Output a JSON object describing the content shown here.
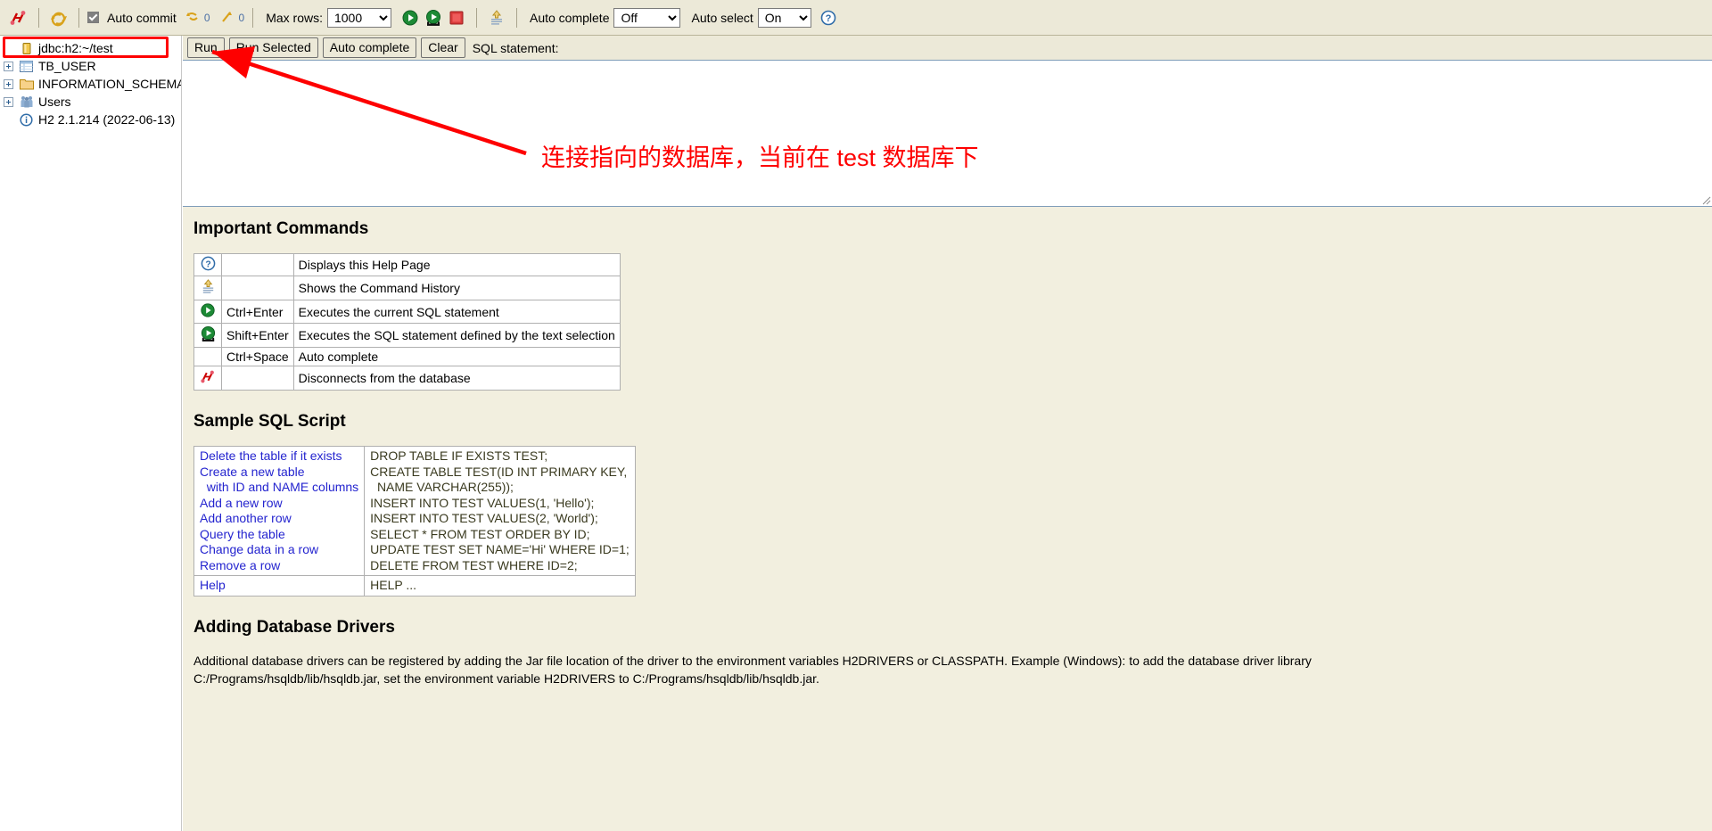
{
  "toolbar": {
    "disconnect_icon": "disconnect-icon",
    "refresh_icon": "refresh-icon",
    "auto_commit_label": "Auto commit",
    "auto_commit_checked": true,
    "commit_icon": "commit-icon",
    "commit_count": "0",
    "rollback_icon": "rollback-icon",
    "rollback_count": "0",
    "max_rows_label": "Max rows:",
    "max_rows_value": "1000",
    "max_rows_options": [
      "1000"
    ],
    "run_icon": "run-icon",
    "run_selected_icon": "run-selected-icon",
    "stop_icon": "stop-icon",
    "history_icon": "history-icon",
    "auto_complete_label": "Auto complete",
    "auto_complete_value": "Off",
    "auto_complete_options": [
      "Off"
    ],
    "auto_select_label": "Auto select",
    "auto_select_value": "On",
    "auto_select_options": [
      "On"
    ],
    "help_icon": "help-icon"
  },
  "tree": {
    "items": [
      {
        "label": "jdbc:h2:~/test",
        "icon": "database-icon",
        "expandable": false,
        "selected": true
      },
      {
        "label": "TB_USER",
        "icon": "table-icon",
        "expandable": true,
        "selected": false
      },
      {
        "label": "INFORMATION_SCHEMA",
        "icon": "folder-icon",
        "expandable": true,
        "selected": false
      },
      {
        "label": "Users",
        "icon": "users-icon",
        "expandable": true,
        "selected": false
      },
      {
        "label": "H2 2.1.214 (2022-06-13)",
        "icon": "info-icon",
        "expandable": false,
        "selected": false
      }
    ]
  },
  "runbar": {
    "run_label": "Run",
    "run_selected_label": "Run Selected",
    "auto_complete_label": "Auto complete",
    "clear_label": "Clear",
    "sql_statement_label": "SQL statement:"
  },
  "editor": {
    "value": "",
    "placeholder": ""
  },
  "sections": {
    "important_commands_title": "Important Commands",
    "sample_sql_title": "Sample SQL Script",
    "adding_drivers_title": "Adding Database Drivers",
    "adding_drivers_text": "Additional database drivers can be registered by adding the Jar file location of the driver to the environment variables H2DRIVERS or CLASSPATH. Example (Windows): to add the database driver library C:/Programs/hsqldb/lib/hsqldb.jar, set the environment variable H2DRIVERS to C:/Programs/hsqldb/lib/hsqldb.jar."
  },
  "important_commands": [
    {
      "icon": "help-icon",
      "key": "",
      "desc": "Displays this Help Page"
    },
    {
      "icon": "history-icon",
      "key": "",
      "desc": "Shows the Command History"
    },
    {
      "icon": "run-icon",
      "key": "Ctrl+Enter",
      "desc": "Executes the current SQL statement"
    },
    {
      "icon": "run-selected-icon",
      "key": "Shift+Enter",
      "desc": "Executes the SQL statement defined by the text selection"
    },
    {
      "icon": "",
      "key": "Ctrl+Space",
      "desc": "Auto complete"
    },
    {
      "icon": "disconnect-icon",
      "key": "",
      "desc": "Disconnects from the database"
    }
  ],
  "sample_sql": {
    "rows": [
      {
        "desc": "Delete the table if it exists",
        "sql": "DROP TABLE IF EXISTS TEST;"
      },
      {
        "desc": "Create a new table\n  with ID and NAME columns",
        "sql": "CREATE TABLE TEST(ID INT PRIMARY KEY,\n  NAME VARCHAR(255));"
      },
      {
        "desc": "Add a new row",
        "sql": "INSERT INTO TEST VALUES(1, 'Hello');"
      },
      {
        "desc": "Add another row",
        "sql": "INSERT INTO TEST VALUES(2, 'World');"
      },
      {
        "desc": "Query the table",
        "sql": "SELECT * FROM TEST ORDER BY ID;"
      },
      {
        "desc": "Change data in a row",
        "sql": "UPDATE TEST SET NAME='Hi' WHERE ID=1;"
      },
      {
        "desc": "Remove a row",
        "sql": "DELETE FROM TEST WHERE ID=2;"
      }
    ],
    "help_row": {
      "desc": "Help",
      "sql": "HELP ..."
    }
  },
  "annotation": {
    "text": "连接指向的数据库，当前在 test 数据库下",
    "color": "#fe0000"
  },
  "colors": {
    "toolbar_bg": "#ece9d8",
    "doc_bg": "#f2efdf",
    "link_blue": "#2424cf",
    "annotation_red": "#fe0000"
  }
}
